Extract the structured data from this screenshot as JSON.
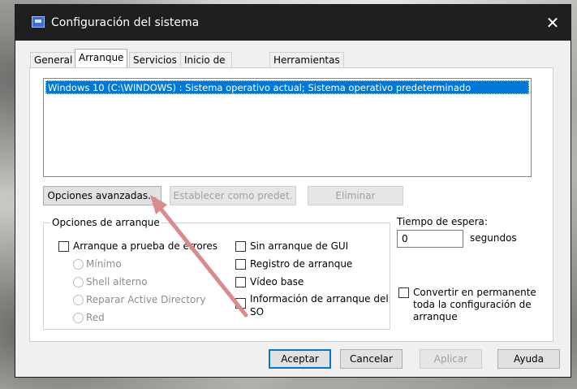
{
  "window": {
    "title": "Configuración del sistema",
    "close_glyph": "✕"
  },
  "tabs": [
    {
      "label": "General",
      "active": false
    },
    {
      "label": "Arranque",
      "active": true
    },
    {
      "label": "Servicios",
      "active": false
    },
    {
      "label": "Inicio de Windows",
      "active": false
    },
    {
      "label": "Herramientas",
      "active": false
    }
  ],
  "os_list": {
    "items": [
      "Windows 10 (C:\\WINDOWS) : Sistema operativo actual; Sistema operativo predeterminado"
    ]
  },
  "list_buttons": {
    "advanced": "Opciones avanzadas...",
    "set_default": "Establecer como predet.",
    "delete": "Eliminar"
  },
  "boot_options": {
    "group_label": "Opciones de arranque",
    "safe_boot": {
      "label": "Arranque a prueba de errores",
      "checked": false
    },
    "radios": [
      {
        "label": "Mínimo"
      },
      {
        "label": "Shell alterno"
      },
      {
        "label": "Reparar Active Directory"
      },
      {
        "label": "Red"
      }
    ],
    "no_gui": {
      "label": "Sin arranque de GUI",
      "checked": false
    },
    "boot_log": {
      "label": "Registro de arranque",
      "checked": false
    },
    "base_video": {
      "label": "Vídeo base",
      "checked": false
    },
    "os_boot_info": {
      "label_line1": "Información de arranque del",
      "label_line2": "SO",
      "checked": false
    }
  },
  "timeout": {
    "label": "Tiempo de espera:",
    "value": "0",
    "unit": "segundos"
  },
  "permanent": {
    "line1": "Convertir en permanente",
    "line2": "toda la configuración de",
    "line3": "arranque",
    "checked": false
  },
  "footer_buttons": {
    "ok": "Aceptar",
    "cancel": "Cancelar",
    "apply": "Aplicar",
    "help": "Ayuda"
  },
  "colors": {
    "selection": "#0078d7",
    "annotation_arrow": "#d98a8a",
    "titlebar": "#1f1f1f"
  }
}
